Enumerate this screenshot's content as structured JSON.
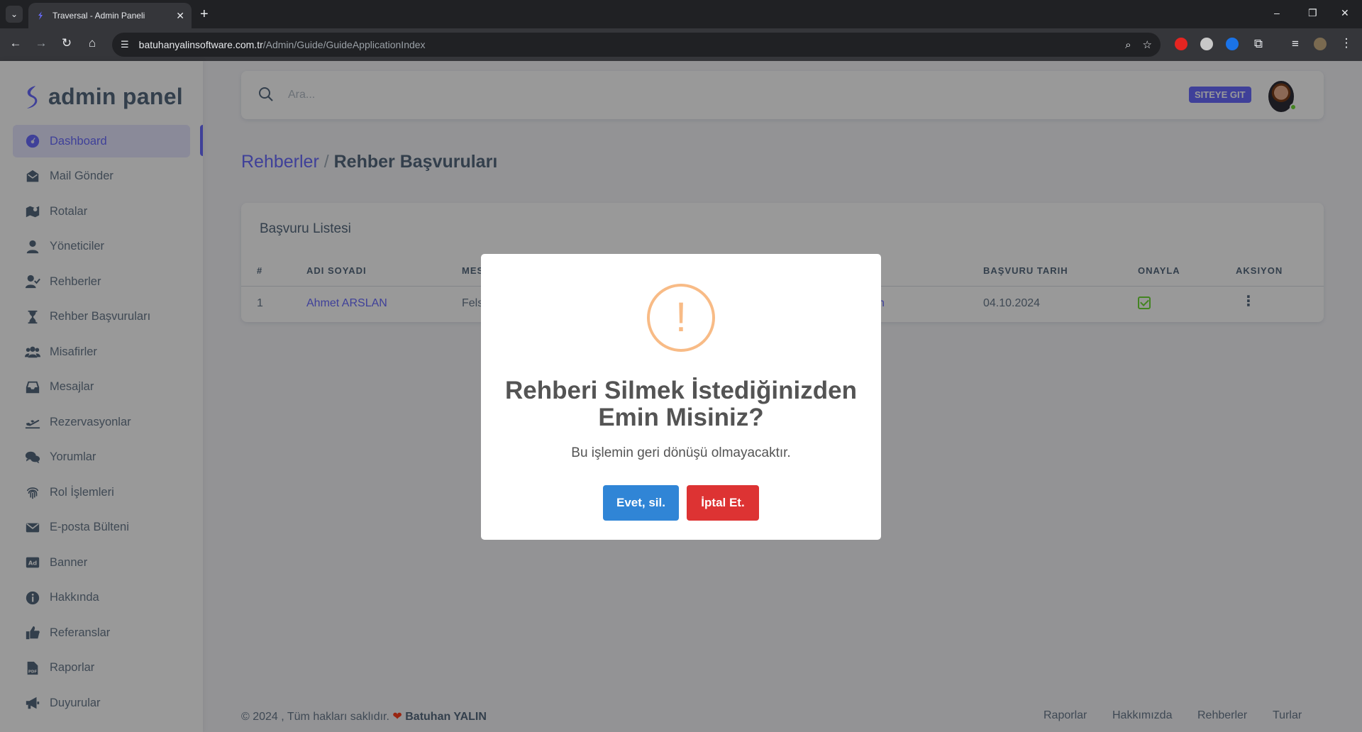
{
  "browser": {
    "tab_title": "Traversal - Admin Paneli",
    "tab_close": "✕",
    "new_tab": "+",
    "url_host": "batuhanyalinsoftware.com.tr",
    "url_path": "/Admin/Guide/GuideApplicationIndex",
    "window_minimize": "–",
    "window_restore": "❐",
    "window_close": "✕"
  },
  "brand": {
    "name": "admin panel",
    "color": "#696cff"
  },
  "sidebar": {
    "items": [
      {
        "label": "Dashboard",
        "icon": "dashboard-icon",
        "active": true
      },
      {
        "label": "Mail Gönder",
        "icon": "mail-send-icon"
      },
      {
        "label": "Rotalar",
        "icon": "map-icon"
      },
      {
        "label": "Yöneticiler",
        "icon": "user-icon"
      },
      {
        "label": "Rehberler",
        "icon": "user-check-icon"
      },
      {
        "label": "Rehber Başvuruları",
        "icon": "hourglass-icon"
      },
      {
        "label": "Misafirler",
        "icon": "users-icon"
      },
      {
        "label": "Mesajlar",
        "icon": "inbox-icon"
      },
      {
        "label": "Rezervasyonlar",
        "icon": "plane-icon"
      },
      {
        "label": "Yorumlar",
        "icon": "comments-icon"
      },
      {
        "label": "Rol İşlemleri",
        "icon": "fingerprint-icon"
      },
      {
        "label": "E-posta Bülteni",
        "icon": "envelope-icon"
      },
      {
        "label": "Banner",
        "icon": "ad-icon"
      },
      {
        "label": "Hakkında",
        "icon": "info-icon"
      },
      {
        "label": "Referanslar",
        "icon": "thumbs-up-icon"
      },
      {
        "label": "Raporlar",
        "icon": "pdf-icon"
      },
      {
        "label": "Duyurular",
        "icon": "megaphone-icon"
      }
    ]
  },
  "navbar": {
    "search_placeholder": "Ara...",
    "site_button": "SITEYE GIT"
  },
  "breadcrumb": {
    "parent": "Rehberler",
    "separator": " / ",
    "current": "Rehber Başvuruları"
  },
  "card": {
    "title": "Başvuru Listesi",
    "columns": [
      "#",
      "ADI SOYADI",
      "MES",
      "BAŞVURU TARIH",
      "ONAYLA",
      "AKSIYON"
    ],
    "rows": [
      {
        "index": "1",
        "name": "Ahmet ARSLAN",
        "partial_message": "Fels",
        "partial_email": "n",
        "date": "04.10.2024"
      }
    ]
  },
  "footer": {
    "copyright": "© 2024 , Tüm hakları saklıdır.",
    "author": "Batuhan YALIN",
    "links": [
      "Raporlar",
      "Hakkımızda",
      "Rehberler",
      "Turlar"
    ]
  },
  "modal": {
    "icon_glyph": "!",
    "title": "Rehberi Silmek İstediğinizden Emin Misiniz?",
    "text": "Bu işlemin geri dönüşü olmayacaktır.",
    "confirm_label": "Evet, sil.",
    "cancel_label": "İptal Et.",
    "confirm_color": "#3085d6",
    "cancel_color": "#dd3333",
    "warning_color": "#f8bb86"
  }
}
